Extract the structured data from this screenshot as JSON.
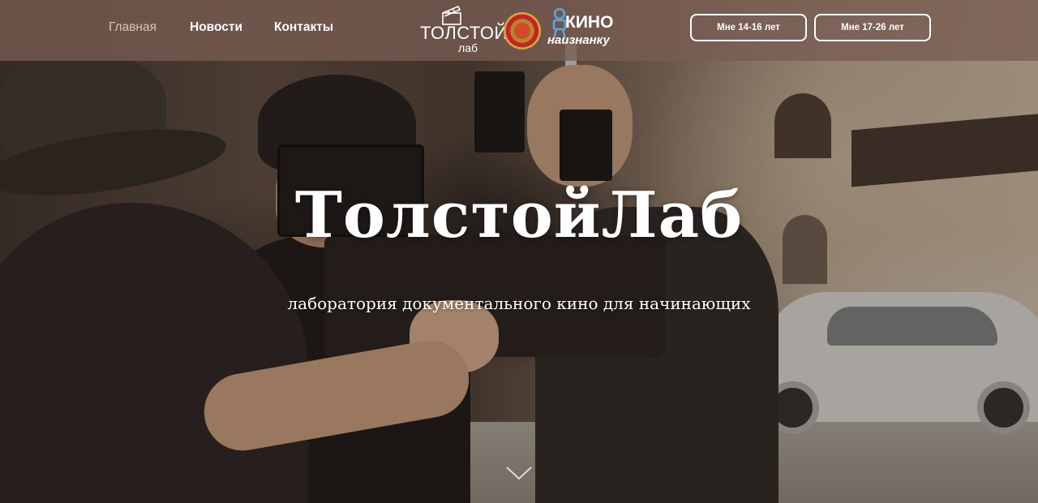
{
  "nav": {
    "items": [
      {
        "label": "Главная",
        "active": true
      },
      {
        "label": "Новости",
        "active": false
      },
      {
        "label": "Контакты",
        "active": false
      }
    ]
  },
  "logos": {
    "tolstoy_line1": "ТОЛСТОЙ",
    "tolstoy_line2": "лаб",
    "kino_line1": "КИНО",
    "kino_line2": "наизнанку",
    "seal_icon": "emblem-seal-icon",
    "clapper_icon": "clapperboard-icon",
    "kino_icon": "film-camera-icon"
  },
  "buttons": {
    "age_14_16": "Мне 14-16 лет",
    "age_17_26": "Мне 17-26 лет"
  },
  "hero": {
    "title": "ТолстойЛаб",
    "subtitle": "лаборатория документального кино для начинающих",
    "scroll_icon": "chevron-down-icon"
  },
  "colors": {
    "header_bg": "#785c52",
    "accent": "#ffffff",
    "active_nav": "#d2c4bd"
  }
}
